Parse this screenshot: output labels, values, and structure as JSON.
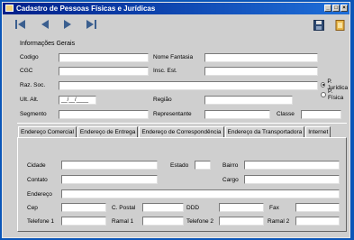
{
  "window": {
    "title": "Cadastro de Pessoas Físicas e Jurídicas"
  },
  "toolbar": {
    "icons": [
      "first-record-icon",
      "prev-record-icon",
      "next-record-icon",
      "last-record-icon",
      "save-icon",
      "exit-icon"
    ]
  },
  "general": {
    "section_title": "Informações Gerais",
    "codigo": "Codigo",
    "nome_fantasia": "Nome Fantasia",
    "cgc": "CGC",
    "insc_est": "Insc. Est.",
    "raz_soc": "Raz. Soc.",
    "ult_alt": "Ult. Alt.",
    "ult_alt_value": "__/__/____",
    "regiao": "Região",
    "segmento": "Segmento",
    "representante": "Representante",
    "classe": "Classe",
    "radio_juridica": "P. Jurídica",
    "radio_fisica": "P. Física"
  },
  "tabs": [
    {
      "label": "Endereço Comercial"
    },
    {
      "label": "Endereço de Entrega"
    },
    {
      "label": "Endereço de Correspondência"
    },
    {
      "label": "Endereço da Transportadora"
    },
    {
      "label": "Internet"
    }
  ],
  "address": {
    "cidade": "Cidade",
    "estado": "Estado",
    "bairro": "Bairro",
    "contato": "Contato",
    "cargo": "Cargo",
    "endereco": "Endereço",
    "cep": "Cep",
    "c_postal": "C. Postal",
    "ddd": "DDD",
    "fax": "Fax",
    "telefone1": "Telefone 1",
    "ramal1": "Ramal 1",
    "telefone2": "Telefone 2",
    "ramal2": "Ramal 2"
  },
  "colors": {
    "titlebar_start": "#00208a",
    "titlebar_end": "#1e6fd9",
    "background": "#0b56b8",
    "window": "#cfcfcf"
  }
}
